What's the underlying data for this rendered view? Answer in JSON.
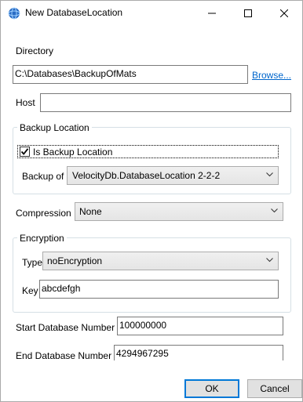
{
  "window": {
    "title": "New DatabaseLocation"
  },
  "directory": {
    "label": "Directory",
    "value": "C:\\Databases\\BackupOfMats",
    "browse_label": "Browse..."
  },
  "host": {
    "label": "Host",
    "value": ""
  },
  "backup_location": {
    "group_title": "Backup Location",
    "checkbox_label": "Is Backup Location",
    "checked": true,
    "backup_of_label": "Backup of",
    "backup_of_value": "VelocityDb.DatabaseLocation 2-2-2"
  },
  "compression": {
    "label": "Compression",
    "value": "None"
  },
  "encryption": {
    "group_title": "Encryption",
    "type_label": "Type",
    "type_value": "noEncryption",
    "key_label": "Key",
    "key_value": "abcdefgh"
  },
  "start_db": {
    "label": "Start Database Number",
    "value": "100000000"
  },
  "end_db": {
    "label": "End Database Number",
    "value": "4294967295"
  },
  "buttons": {
    "ok": "OK",
    "cancel": "Cancel"
  }
}
